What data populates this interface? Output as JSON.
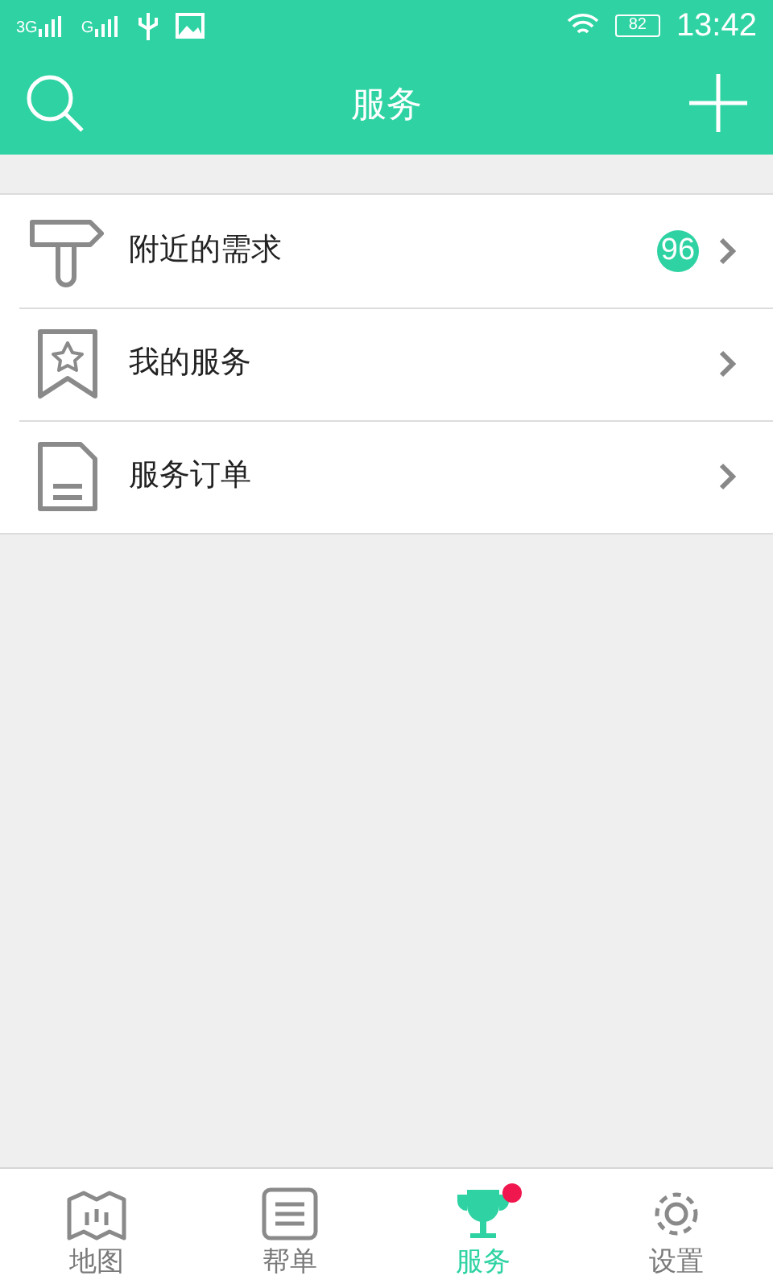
{
  "status_bar": {
    "signals": [
      "3G",
      "G"
    ],
    "battery": "82",
    "time": "13:42"
  },
  "header": {
    "title": "服务"
  },
  "menu": [
    {
      "kind": "signpost",
      "label": "附近的需求",
      "badge": "96"
    },
    {
      "kind": "bookmark",
      "label": "我的服务"
    },
    {
      "kind": "document",
      "label": "服务订单"
    }
  ],
  "tabs": [
    {
      "kind": "map",
      "label": "地图",
      "selected": false,
      "dot": false
    },
    {
      "kind": "list",
      "label": "帮单",
      "selected": false,
      "dot": false
    },
    {
      "kind": "trophy",
      "label": "服务",
      "selected": true,
      "dot": true
    },
    {
      "kind": "gear",
      "label": "设置",
      "selected": false,
      "dot": false
    }
  ]
}
